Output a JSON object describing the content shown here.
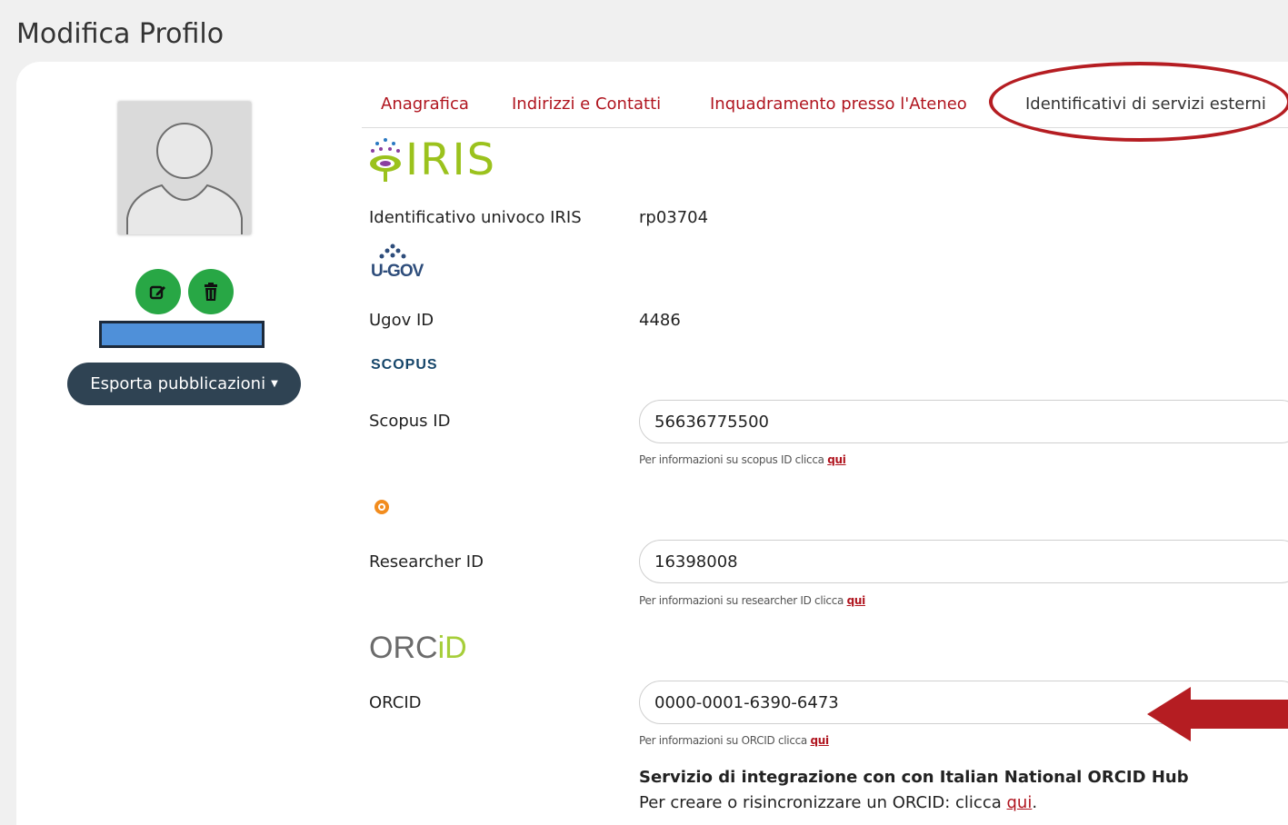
{
  "page": {
    "title": "Modifica Profilo"
  },
  "sidebar": {
    "export_label": "Esporta pubblicazioni"
  },
  "tabs": [
    {
      "label": "Anagrafica"
    },
    {
      "label": "Indirizzi e Contatti"
    },
    {
      "label": "Inquadramento presso l'Ateneo"
    },
    {
      "label": "Identificativi di servizi esterni"
    }
  ],
  "iris": {
    "logo_text": "IRIS",
    "label": "Identificativo univoco IRIS",
    "value": "rp03704"
  },
  "ugov": {
    "logo_text": "U-GOV",
    "label": "Ugov ID",
    "value": "4486"
  },
  "scopus": {
    "logo_text": "SCOPUS",
    "label": "Scopus ID",
    "value": "56636775500",
    "help_text": "Per informazioni su scopus ID clicca",
    "help_link": "qui"
  },
  "researcher": {
    "label": "Researcher ID",
    "value": "16398008",
    "help_text": "Per informazioni su researcher ID clicca",
    "help_link": "qui"
  },
  "orcid": {
    "logo_text": "ORC",
    "logo_id": "iD",
    "label": "ORCID",
    "value": "0000-0001-6390-6473",
    "help_text": "Per informazioni su ORCID clicca",
    "help_link": "qui"
  },
  "hub": {
    "title": "Servizio di integrazione con con Italian National ORCID Hub",
    "text": "Per creare o risincronizzare un ORCID: clicca",
    "link": "qui",
    "suffix": "."
  },
  "colors": {
    "accent": "#b0151f",
    "green": "#28a745",
    "dark": "#2f4353",
    "highlight": "#b51d22"
  }
}
